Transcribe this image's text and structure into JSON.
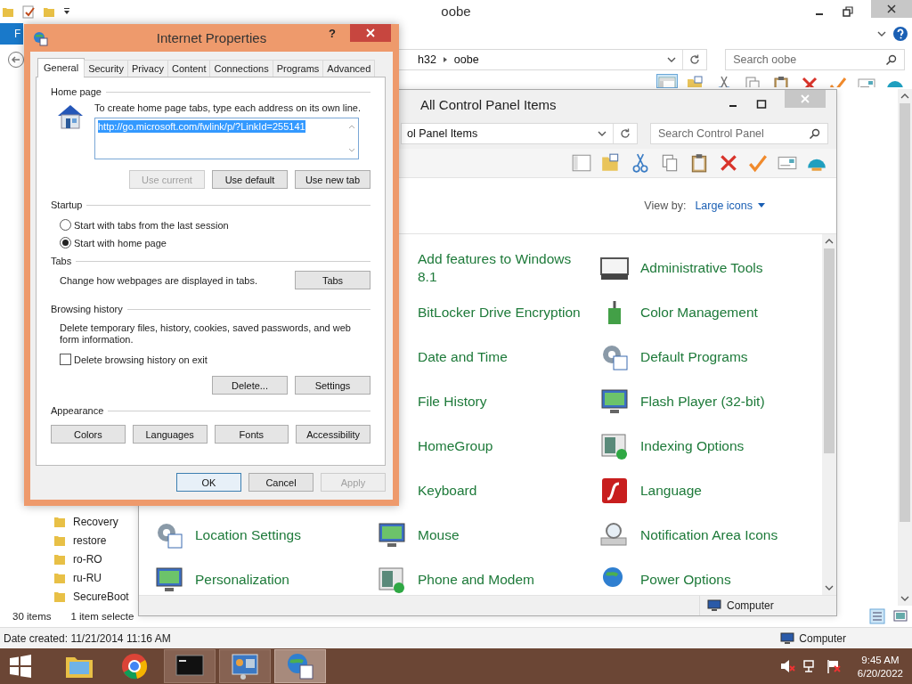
{
  "explorer": {
    "title": "oobe",
    "ribbon_tab": "F",
    "address": [
      "h32",
      "oobe"
    ],
    "search": {
      "placeholder": "Search oobe"
    },
    "nav_items": [
      "Recovery",
      "restore",
      "ro-RO",
      "ru-RU",
      "SecureBoot"
    ],
    "status": {
      "item_count": "30 items",
      "selection": "1 item selecte"
    },
    "details": {
      "date_created": "Date created: 11/21/2014 11:16 AM",
      "location": "Computer"
    }
  },
  "control_panel": {
    "title": "All Control Panel Items",
    "address": "ol Panel Items",
    "search": {
      "placeholder": "Search Control Panel"
    },
    "view_by_label": "View by:",
    "view_by_value": "Large icons",
    "columns": [
      [
        "Location Settings",
        "Personalization"
      ],
      [
        "Add features to Windows 8.1",
        "BitLocker Drive Encryption",
        "Date and Time",
        "File History",
        "HomeGroup",
        "Keyboard",
        "Mouse",
        "Phone and Modem"
      ],
      [
        "Administrative Tools",
        "Color Management",
        "Default Programs",
        "Flash Player (32-bit)",
        "Indexing Options",
        "Language",
        "Notification Area Icons",
        "Power Options"
      ]
    ],
    "status": "Computer"
  },
  "dialog": {
    "title": "Internet Properties",
    "help": "?",
    "tabs": [
      {
        "label": "General",
        "selected": true
      },
      {
        "label": "Security",
        "selected": false
      },
      {
        "label": "Privacy",
        "selected": false
      },
      {
        "label": "Content",
        "selected": false
      },
      {
        "label": "Connections",
        "selected": false
      },
      {
        "label": "Programs",
        "selected": false
      },
      {
        "label": "Advanced",
        "selected": false
      }
    ],
    "home_page": {
      "heading": "Home page",
      "instruction": "To create home page tabs, type each address on its own line.",
      "value": "http://go.microsoft.com/fwlink/p/?LinkId=255141",
      "buttons": [
        {
          "label": "Use current",
          "disabled": true
        },
        {
          "label": "Use default",
          "disabled": false
        },
        {
          "label": "Use new tab",
          "disabled": false
        }
      ]
    },
    "startup": {
      "heading": "Startup",
      "options": [
        {
          "label": "Start with tabs from the last session",
          "selected": false
        },
        {
          "label": "Start with home page",
          "selected": true
        }
      ]
    },
    "tabs_section": {
      "heading": "Tabs",
      "description": "Change how webpages are displayed in tabs.",
      "button": "Tabs"
    },
    "browsing_history": {
      "heading": "Browsing history",
      "description": "Delete temporary files, history, cookies, saved passwords, and web form information.",
      "checkbox": {
        "label": "Delete browsing history on exit",
        "checked": false
      },
      "buttons": [
        "Delete...",
        "Settings"
      ]
    },
    "appearance": {
      "heading": "Appearance",
      "buttons": [
        "Colors",
        "Languages",
        "Fonts",
        "Accessibility"
      ]
    },
    "footer_buttons": [
      {
        "label": "OK",
        "default": true,
        "disabled": false
      },
      {
        "label": "Cancel",
        "default": false,
        "disabled": false
      },
      {
        "label": "Apply",
        "default": false,
        "disabled": true
      }
    ]
  },
  "taskbar": {
    "apps": [
      {
        "kind": "folder",
        "active": false
      },
      {
        "kind": "browser",
        "active": false
      },
      {
        "kind": "terminal",
        "active": false
      },
      {
        "kind": "control-panel",
        "active": false
      },
      {
        "kind": "internet-options",
        "active": true
      }
    ],
    "clock": {
      "time": "9:45 AM",
      "date": "6/20/2022"
    }
  }
}
